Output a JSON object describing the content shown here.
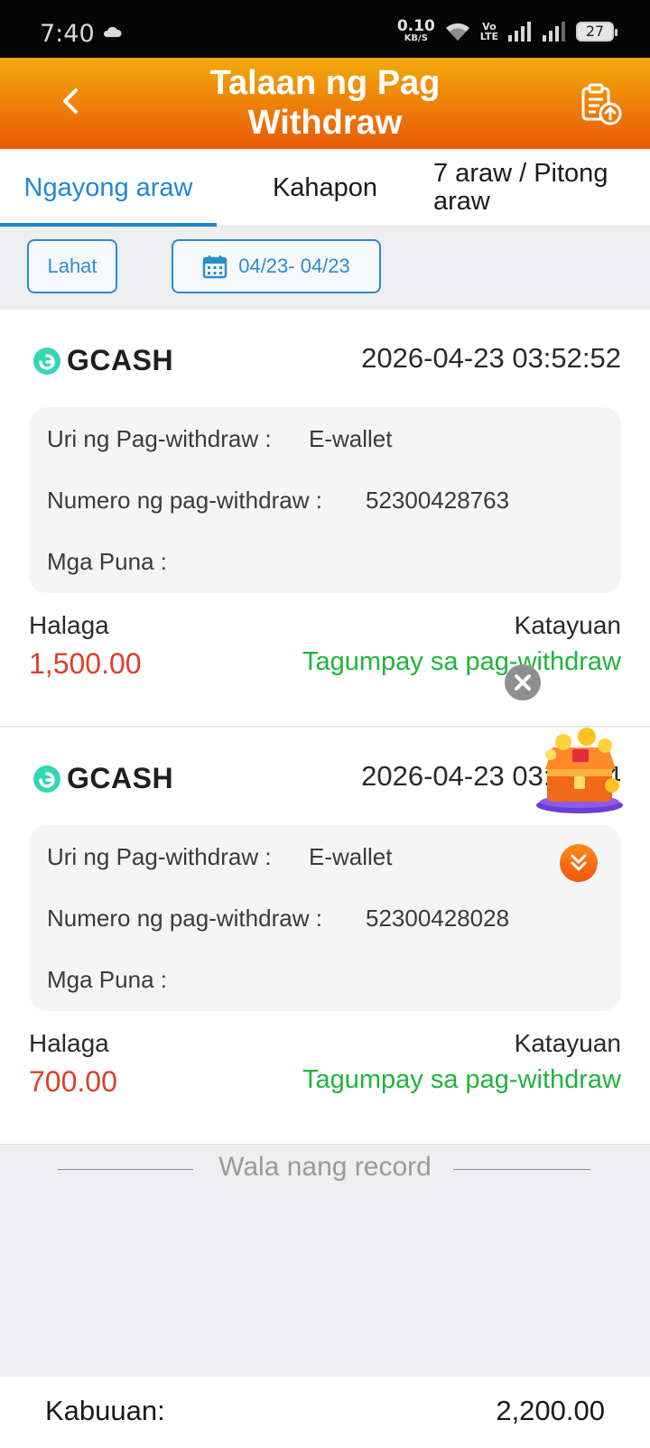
{
  "statusbar": {
    "time": "7:40",
    "net_speed_value": "0.10",
    "net_speed_unit": "KB/S",
    "volte_top": "Vo",
    "volte_bottom": "LTE",
    "battery": "27"
  },
  "header": {
    "title": "Talaan ng Pag Withdraw",
    "back_icon": "chevron-left-icon",
    "action_icon": "clipboard-upload-icon"
  },
  "tabs": [
    {
      "label": "Ngayong araw",
      "active": true
    },
    {
      "label": "Kahapon",
      "active": false
    },
    {
      "label": "7 araw / Pitong araw",
      "active": false
    }
  ],
  "filters": {
    "all_label": "Lahat",
    "date_range": "04/23- 04/23"
  },
  "records": [
    {
      "provider": "GCASH",
      "datetime": "2026-04-23 03:52:52",
      "type_label": "Uri ng Pag-withdraw",
      "type_value": "E-wallet",
      "number_label": "Numero ng pag-withdraw",
      "number_value": "52300428763",
      "remarks_label": "Mga Puna",
      "remarks_value": "",
      "amount_label": "Halaga",
      "amount": "1,500.00",
      "status_label": "Katayuan",
      "status": "Tagumpay sa pag-withdraw"
    },
    {
      "provider": "GCASH",
      "datetime": "2026-04-23 03:__:_4",
      "type_label": "Uri ng Pag-withdraw",
      "type_value": "E-wallet",
      "number_label": "Numero ng pag-withdraw",
      "number_value": "52300428028",
      "remarks_label": "Mga Puna",
      "remarks_value": "",
      "amount_label": "Halaga",
      "amount": "700.00",
      "status_label": "Katayuan",
      "status": "Tagumpay sa pag-withdraw"
    }
  ],
  "no_more": "Wala nang record",
  "footer": {
    "total_label": "Kabuuan:",
    "total_value": "2,200.00"
  },
  "colors": {
    "accent": "#1f88d1",
    "header_top": "#f2ab0c",
    "header_bottom": "#e85a08",
    "amount": "#d8412a",
    "success": "#1fb43a"
  }
}
